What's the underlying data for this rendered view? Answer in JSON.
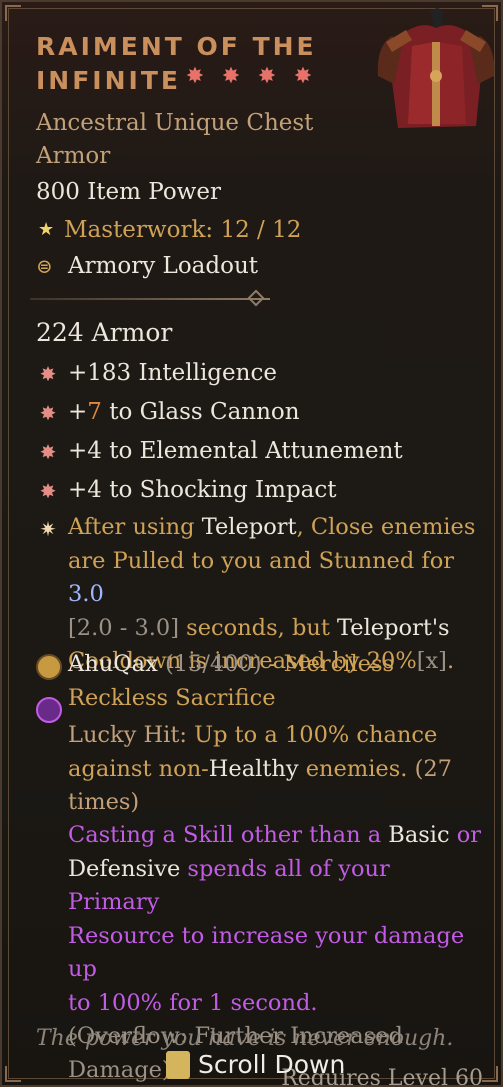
{
  "item": {
    "title_line1": "RAIMENT OF THE",
    "title_line2": "INFINITE",
    "greater_affix_icons": [
      "greater-affix-icon",
      "greater-affix-icon",
      "greater-affix-icon",
      "greater-affix-icon"
    ],
    "type_line1": "Ancestral Unique Chest",
    "type_line2": "Armor",
    "item_power": "800 Item Power",
    "masterwork": "Masterwork: 12 / 12",
    "loadout": "Armory Loadout",
    "armor": "224 Armor"
  },
  "affixes": [
    {
      "prefix": "+183 Intelligence",
      "value": "",
      "suffix": ""
    },
    {
      "prefix": "+",
      "value": "7",
      "suffix": " to Glass Cannon"
    },
    {
      "prefix": "+4 to Elemental Attunement",
      "value": "",
      "suffix": ""
    },
    {
      "prefix": "+4 to Shocking Impact",
      "value": "",
      "suffix": ""
    }
  ],
  "unique": {
    "l1a": "After using ",
    "l1b": "Teleport",
    "l1c": ", Close enemies",
    "l2a": "are Pulled to you and Stunned for ",
    "l2b": "3.0",
    "l3a": "[2.0 - 3.0]",
    "l3b": " seconds, but ",
    "l3c": "Teleport's",
    "l4a": "Cooldown is increased by 20%",
    "l4b": "[x]",
    "l4c": "."
  },
  "glyph": {
    "name": "AhuQax",
    "progress": "(15/400)",
    "dash": " - ",
    "aspect": "Merciless",
    "aspect2": "Reckless Sacrifice"
  },
  "lucky": {
    "l1a": "Lucky Hit: ",
    "l1b": "Up to a 100% chance",
    "l2a": "against non-",
    "l2b": "Healthy",
    "l2c": " enemies.",
    "l2d": " (27",
    "l3": "times)"
  },
  "effect": {
    "l1a": "Casting a Skill other than a ",
    "l1b": "Basic",
    "l1c": " or",
    "l2a": "Defensive",
    "l2b": " spends all of your Primary",
    "l3": "Resource to increase your damage up",
    "l4": "to 100% for 1 second.",
    "l5": "(Overflow: Further Increased",
    "l6": "Damage)"
  },
  "flavor": "The power you have is never enough.",
  "scroll": "Scroll Down",
  "requires": "Requires Level 60",
  "colors": {
    "unique_gold": "#c98f5d",
    "affix_red": "#e48d86",
    "purple": "#c25ce6",
    "blue_value": "#a0b7ff"
  }
}
